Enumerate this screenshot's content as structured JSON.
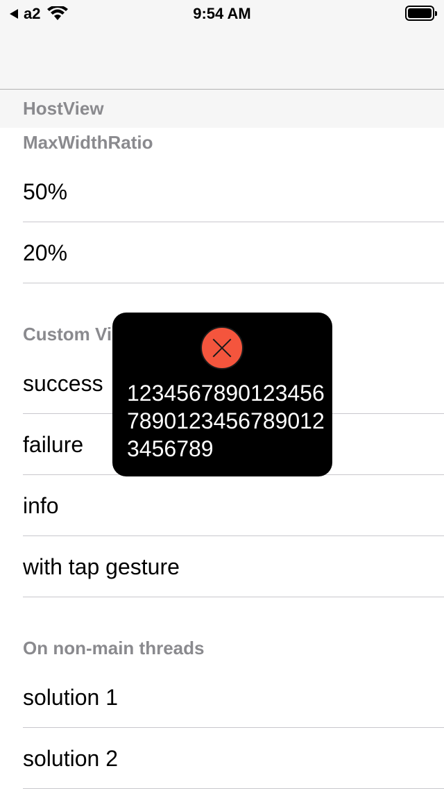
{
  "status_bar": {
    "back_app": "a2",
    "time": "9:54 AM"
  },
  "sections": [
    {
      "header": "HostView",
      "subheader": "MaxWidthRatio",
      "rows": [
        "50%",
        "20%"
      ]
    },
    {
      "header": "Custom View",
      "rows": [
        "success",
        "failure",
        "info",
        "with tap gesture"
      ]
    },
    {
      "header": "On non-main threads",
      "rows": [
        "solution 1",
        "solution 2"
      ]
    }
  ],
  "toast": {
    "message": "123456789012345678901234567890123456789",
    "icon": "close-icon",
    "background": "#000000",
    "icon_color": "#f4553d"
  }
}
